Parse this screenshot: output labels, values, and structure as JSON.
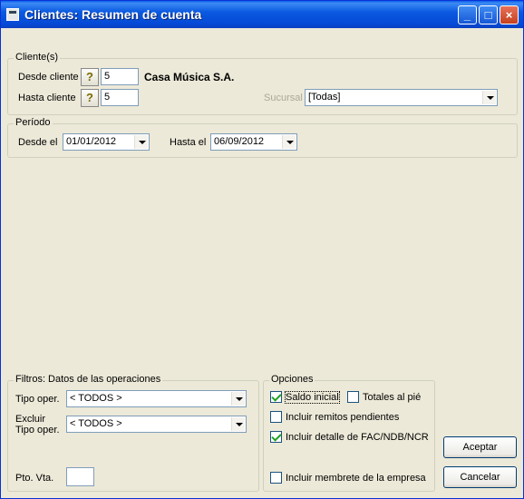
{
  "window": {
    "title": "Clientes: Resumen de cuenta"
  },
  "clientes": {
    "group_title": "Cliente(s)",
    "desde_label": "Desde cliente",
    "desde_value": "5",
    "cliente_name": "Casa Música S.A.",
    "hasta_label": "Hasta cliente",
    "hasta_value": "5",
    "sucursal_label": "Sucursal",
    "sucursal_value": "[Todas]"
  },
  "periodo": {
    "group_title": "Período",
    "desde_label": "Desde el",
    "desde_value": "01/01/2012",
    "hasta_label": "Hasta el",
    "hasta_value": "06/09/2012"
  },
  "filtros": {
    "group_title": "Filtros: Datos de las operaciones",
    "tipo_label": "Tipo oper.",
    "tipo_value": "< TODOS >",
    "excluir_label_1": "Excluir",
    "excluir_label_2": "Tipo oper.",
    "excluir_value": "< TODOS >",
    "pto_label": "Pto. Vta.",
    "pto_value": ""
  },
  "opciones": {
    "group_title": "Opciones",
    "saldo_inicial": {
      "label": "Saldo inicial",
      "checked": true
    },
    "totales": {
      "label": "Totales al pié",
      "checked": false
    },
    "remitos": {
      "label": "Incluir remitos pendientes",
      "checked": false
    },
    "detalle": {
      "label": "Incluir detalle de FAC/NDB/NCR",
      "checked": true
    },
    "membrete": {
      "label": "Incluir membrete de la empresa",
      "checked": false
    }
  },
  "buttons": {
    "aceptar": "Aceptar",
    "cancelar": "Cancelar"
  }
}
